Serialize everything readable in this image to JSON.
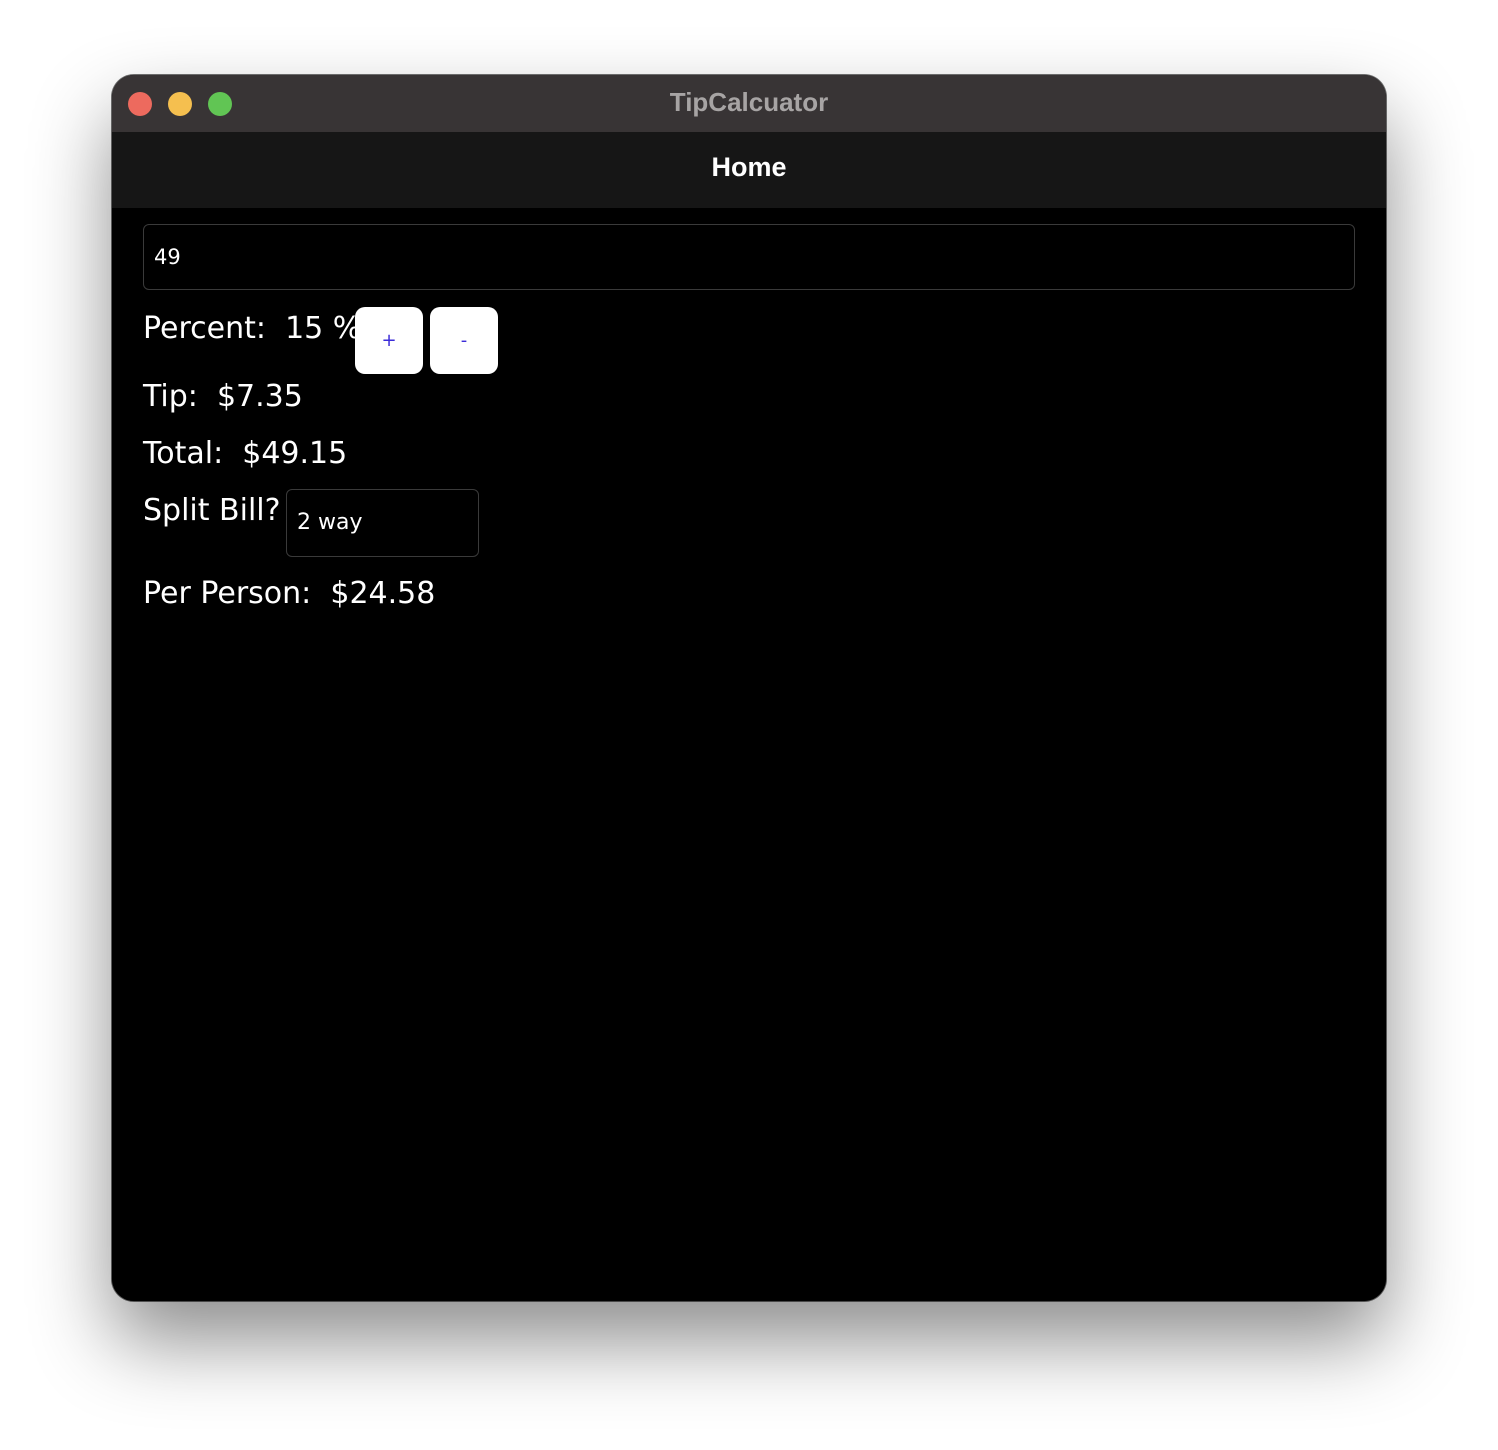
{
  "window": {
    "title": "TipCalcuator"
  },
  "nav": {
    "title": "Home"
  },
  "bill": {
    "value": "49"
  },
  "percent": {
    "label": "Percent:",
    "value": "15 %",
    "increment_label": "+",
    "decrement_label": "-"
  },
  "tip": {
    "label": "Tip:",
    "value": "$7.35"
  },
  "total": {
    "label": "Total:",
    "value": "$49.15"
  },
  "split": {
    "label": "Split Bill?",
    "selected": "2 way"
  },
  "per_person": {
    "label": "Per Person:",
    "value": "$24.58"
  },
  "colors": {
    "background": "#000000",
    "titlebar": "#383435",
    "navbar": "#161616",
    "button_text": "#3b2bd8",
    "close": "#ed6a5e",
    "minimize": "#f5bf4f",
    "maximize": "#61c554"
  }
}
